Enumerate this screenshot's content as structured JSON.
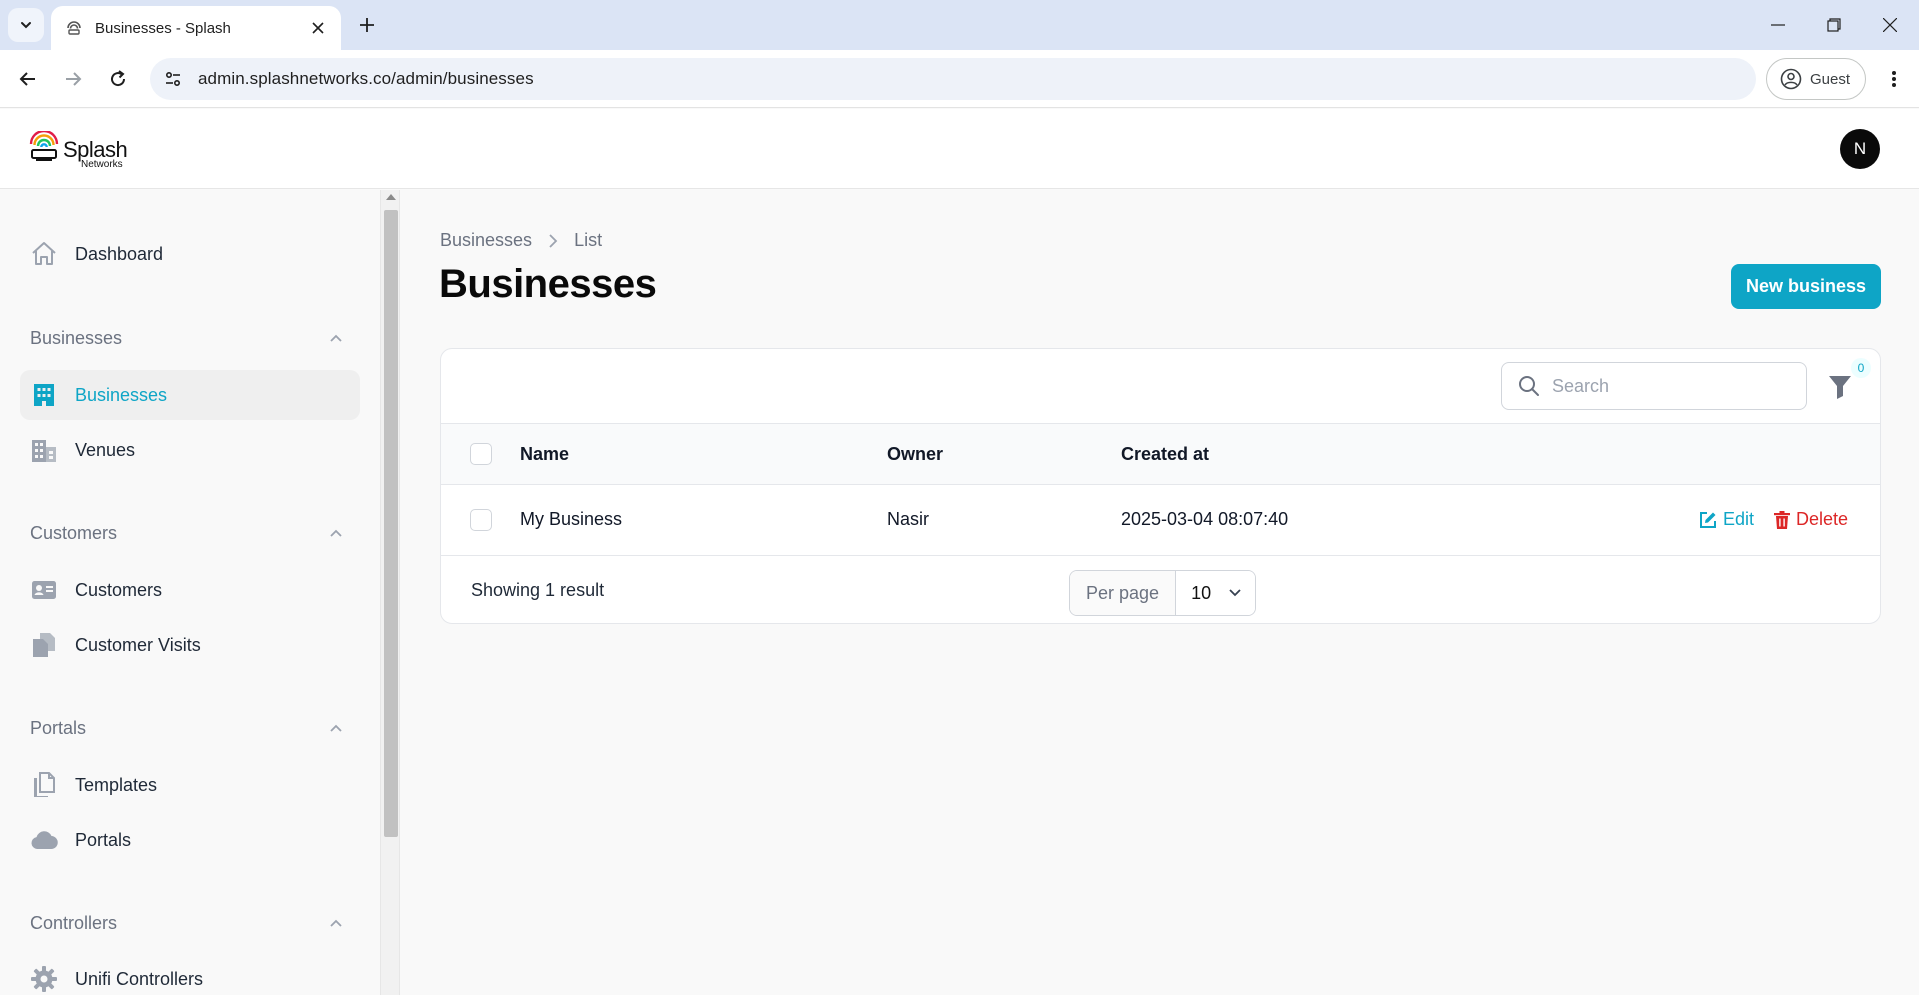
{
  "browser": {
    "tab_title": "Businesses - Splash",
    "url": "admin.splashnetworks.co/admin/businesses",
    "profile_label": "Guest"
  },
  "app": {
    "logo_word": "Splash",
    "logo_sub": "Networks",
    "avatar_initial": "N"
  },
  "sidebar": {
    "dashboard": "Dashboard",
    "groups": [
      {
        "label": "Businesses",
        "items": [
          {
            "label": "Businesses",
            "icon": "building-icon",
            "active": true
          },
          {
            "label": "Venues",
            "icon": "buildings-icon"
          }
        ]
      },
      {
        "label": "Customers",
        "items": [
          {
            "label": "Customers",
            "icon": "id-card-icon"
          },
          {
            "label": "Customer Visits",
            "icon": "documents-icon"
          }
        ]
      },
      {
        "label": "Portals",
        "items": [
          {
            "label": "Templates",
            "icon": "files-icon"
          },
          {
            "label": "Portals",
            "icon": "cloud-icon"
          }
        ]
      },
      {
        "label": "Controllers",
        "items": [
          {
            "label": "Unifi Controllers",
            "icon": "gear-icon"
          }
        ]
      }
    ]
  },
  "main": {
    "breadcrumb": [
      "Businesses",
      "List"
    ],
    "title": "Businesses",
    "new_button": "New business",
    "search_placeholder": "Search",
    "filter_count": "0",
    "columns": [
      "Name",
      "Owner",
      "Created at"
    ],
    "rows": [
      {
        "name": "My Business",
        "owner": "Nasir",
        "created_at": "2025-03-04 08:07:40"
      }
    ],
    "actions": {
      "edit": "Edit",
      "delete": "Delete"
    },
    "footer": {
      "result_text": "Showing 1 result",
      "per_page_label": "Per page",
      "per_page_value": "10"
    }
  },
  "colors": {
    "accent": "#0ea5c6",
    "danger": "#dc2626"
  }
}
